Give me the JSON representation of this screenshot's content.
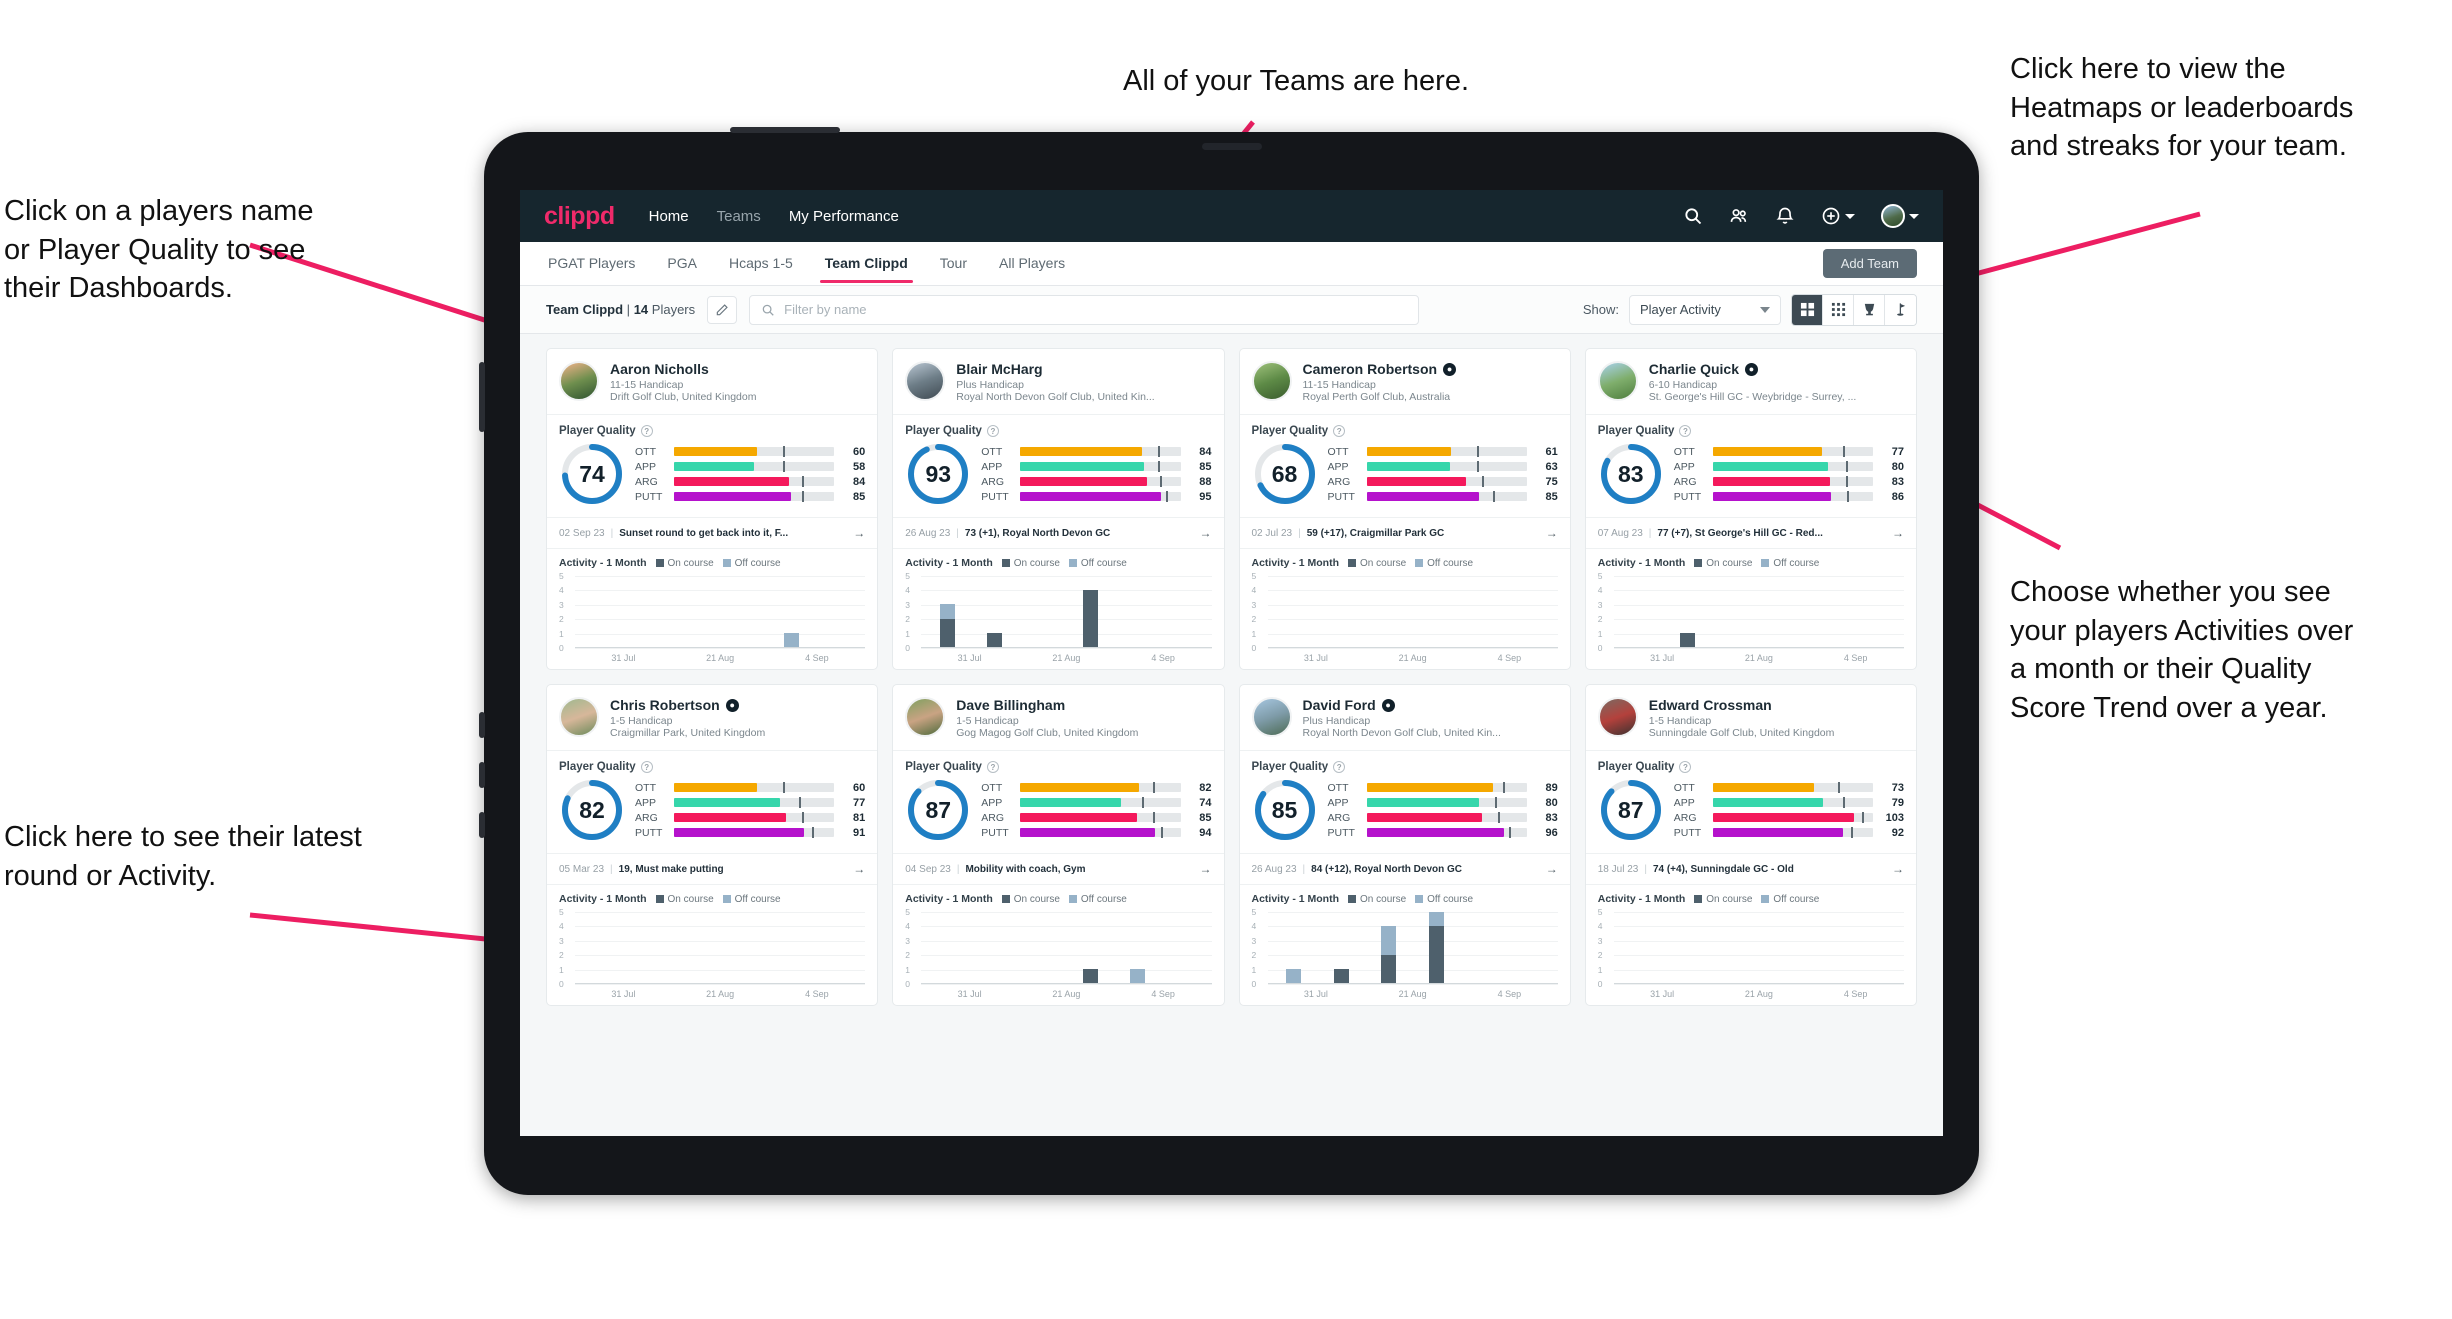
{
  "annotations": [
    {
      "id": "teams-note",
      "text": "All of your Teams are here."
    },
    {
      "id": "heatmaps-note",
      "text": "Click here to view the\nHeatmaps or leaderboards\nand streaks for your team."
    },
    {
      "id": "players-note",
      "text": "Click on a players name\nor Player Quality to see\ntheir Dashboards."
    },
    {
      "id": "activity-note",
      "text": "Choose whether you see\nyour players Activities over\na month or their Quality\nScore Trend over a year."
    },
    {
      "id": "latest-note",
      "text": "Click here to see their latest\nround or Activity."
    }
  ],
  "arrow_color": "#ed1e62",
  "app": {
    "brand": "clippd",
    "nav": [
      {
        "label": "Home",
        "active": true
      },
      {
        "label": "Teams",
        "active": false
      },
      {
        "label": "My Performance",
        "active": true
      }
    ],
    "top_icons": [
      "search-icon",
      "people-icon",
      "bell-icon",
      "plus-circle-icon",
      "avatar"
    ],
    "tabs": [
      {
        "label": "PGAT Players",
        "active": false
      },
      {
        "label": "PGA",
        "active": false
      },
      {
        "label": "Hcaps 1-5",
        "active": false
      },
      {
        "label": "Team Clippd",
        "active": true
      },
      {
        "label": "Tour",
        "active": false
      },
      {
        "label": "All Players",
        "active": false
      }
    ],
    "add_team_label": "Add Team",
    "filter": {
      "team_name": "Team Clippd",
      "separator": "|",
      "player_count": "14",
      "players_word": "Players",
      "edit_icon": "pencil-icon",
      "search_placeholder": "Filter by name",
      "show_label": "Show:",
      "show_value": "Player Activity",
      "view_buttons": [
        "grid-large-icon",
        "grid-small-icon",
        "trophy-icon",
        "flag-icon"
      ],
      "active_view": 0
    }
  },
  "quality_colors": {
    "OTT": "#f5a800",
    "APP": "#36d6ab",
    "ARG": "#f4195c",
    "PUTT": "#b512cc",
    "ring": "#1f7fc4",
    "track": "#e4e7e9"
  },
  "activity_colors": {
    "on_course": "#4e606c",
    "off_course": "#96b2c8"
  },
  "activity_legend": {
    "title": "Activity - 1 Month",
    "on": "On course",
    "off": "Off course"
  },
  "activity_axis": {
    "y_ticks": [
      "5",
      "4",
      "3",
      "2",
      "1",
      "0"
    ],
    "x_ticks": [
      "31 Jul",
      "21 Aug",
      "4 Sep"
    ],
    "ymax": 5
  },
  "card_labels": {
    "player_quality": "Player Quality",
    "help": "?"
  },
  "players": [
    {
      "name": "Aaron Nicholls",
      "verified": false,
      "handicap": "11-15 Handicap",
      "club": "Drift Golf Club, United Kingdom",
      "score": 74,
      "metrics": [
        {
          "key": "OTT",
          "value": 60,
          "fill": 52,
          "tick": 68
        },
        {
          "key": "APP",
          "value": 58,
          "fill": 50,
          "tick": 68
        },
        {
          "key": "ARG",
          "value": 84,
          "fill": 72,
          "tick": 80
        },
        {
          "key": "PUTT",
          "value": 85,
          "fill": 73,
          "tick": 80
        }
      ],
      "latest_date": "02 Sep 23",
      "latest_text": "Sunset round to get back into it, F...",
      "chart_data": {
        "type": "bar",
        "on": [
          0,
          0,
          0,
          0,
          0,
          0
        ],
        "off": [
          0,
          0,
          0,
          0,
          1,
          0
        ]
      }
    },
    {
      "name": "Blair McHarg",
      "verified": false,
      "handicap": "Plus Handicap",
      "club": "Royal North Devon Golf Club, United Kin...",
      "score": 93,
      "metrics": [
        {
          "key": "OTT",
          "value": 84,
          "fill": 76,
          "tick": 86
        },
        {
          "key": "APP",
          "value": 85,
          "fill": 77,
          "tick": 86
        },
        {
          "key": "ARG",
          "value": 88,
          "fill": 79,
          "tick": 87
        },
        {
          "key": "PUTT",
          "value": 95,
          "fill": 88,
          "tick": 91
        }
      ],
      "latest_date": "26 Aug 23",
      "latest_text": "73 (+1), Royal North Devon GC",
      "chart_data": {
        "type": "bar",
        "on": [
          2,
          1,
          0,
          4,
          0,
          0
        ],
        "off": [
          1,
          0,
          0,
          0,
          0,
          0
        ]
      }
    },
    {
      "name": "Cameron Robertson",
      "verified": true,
      "handicap": "11-15 Handicap",
      "club": "Royal Perth Golf Club, Australia",
      "score": 68,
      "metrics": [
        {
          "key": "OTT",
          "value": 61,
          "fill": 53,
          "tick": 69
        },
        {
          "key": "APP",
          "value": 63,
          "fill": 52,
          "tick": 69
        },
        {
          "key": "ARG",
          "value": 75,
          "fill": 62,
          "tick": 72
        },
        {
          "key": "PUTT",
          "value": 85,
          "fill": 70,
          "tick": 79
        }
      ],
      "latest_date": "02 Jul 23",
      "latest_text": "59 (+17), Craigmillar Park GC",
      "chart_data": {
        "type": "bar",
        "on": [
          0,
          0,
          0,
          0,
          0,
          0
        ],
        "off": [
          0,
          0,
          0,
          0,
          0,
          0
        ]
      }
    },
    {
      "name": "Charlie Quick",
      "verified": true,
      "handicap": "6-10 Handicap",
      "club": "St. George's Hill GC - Weybridge - Surrey, ...",
      "score": 83,
      "metrics": [
        {
          "key": "OTT",
          "value": 77,
          "fill": 68,
          "tick": 81
        },
        {
          "key": "APP",
          "value": 80,
          "fill": 72,
          "tick": 83
        },
        {
          "key": "ARG",
          "value": 83,
          "fill": 73,
          "tick": 83
        },
        {
          "key": "PUTT",
          "value": 86,
          "fill": 74,
          "tick": 84
        }
      ],
      "latest_date": "07 Aug 23",
      "latest_text": "77 (+7), St George's Hill GC - Red...",
      "chart_data": {
        "type": "bar",
        "on": [
          0,
          1,
          0,
          0,
          0,
          0
        ],
        "off": [
          0,
          0,
          0,
          0,
          0,
          0
        ]
      }
    },
    {
      "name": "Chris Robertson",
      "verified": true,
      "handicap": "1-5 Handicap",
      "club": "Craigmillar Park, United Kingdom",
      "score": 82,
      "metrics": [
        {
          "key": "OTT",
          "value": 60,
          "fill": 52,
          "tick": 68
        },
        {
          "key": "APP",
          "value": 77,
          "fill": 66,
          "tick": 78
        },
        {
          "key": "ARG",
          "value": 81,
          "fill": 70,
          "tick": 80
        },
        {
          "key": "PUTT",
          "value": 91,
          "fill": 81,
          "tick": 86
        }
      ],
      "latest_date": "05 Mar 23",
      "latest_text": "19, Must make putting",
      "chart_data": {
        "type": "bar",
        "on": [
          0,
          0,
          0,
          0,
          0,
          0
        ],
        "off": [
          0,
          0,
          0,
          0,
          0,
          0
        ]
      }
    },
    {
      "name": "Dave Billingham",
      "verified": false,
      "handicap": "1-5 Handicap",
      "club": "Gog Magog Golf Club, United Kingdom",
      "score": 87,
      "metrics": [
        {
          "key": "OTT",
          "value": 82,
          "fill": 74,
          "tick": 83
        },
        {
          "key": "APP",
          "value": 74,
          "fill": 63,
          "tick": 76
        },
        {
          "key": "ARG",
          "value": 85,
          "fill": 73,
          "tick": 83
        },
        {
          "key": "PUTT",
          "value": 94,
          "fill": 84,
          "tick": 88
        }
      ],
      "latest_date": "04 Sep 23",
      "latest_text": "Mobility with coach, Gym",
      "chart_data": {
        "type": "bar",
        "on": [
          0,
          0,
          0,
          1,
          0,
          0
        ],
        "off": [
          0,
          0,
          0,
          0,
          1,
          0
        ]
      }
    },
    {
      "name": "David Ford",
      "verified": true,
      "handicap": "Plus Handicap",
      "club": "Royal North Devon Golf Club, United Kin...",
      "score": 85,
      "metrics": [
        {
          "key": "OTT",
          "value": 89,
          "fill": 79,
          "tick": 85
        },
        {
          "key": "APP",
          "value": 80,
          "fill": 70,
          "tick": 80
        },
        {
          "key": "ARG",
          "value": 83,
          "fill": 72,
          "tick": 82
        },
        {
          "key": "PUTT",
          "value": 96,
          "fill": 86,
          "tick": 89
        }
      ],
      "latest_date": "26 Aug 23",
      "latest_text": "84 (+12), Royal North Devon GC",
      "chart_data": {
        "type": "bar",
        "on": [
          0,
          1,
          2,
          4,
          0,
          0
        ],
        "off": [
          1,
          0,
          2,
          1,
          0,
          0
        ]
      }
    },
    {
      "name": "Edward Crossman",
      "verified": false,
      "handicap": "1-5 Handicap",
      "club": "Sunningdale Golf Club, United Kingdom",
      "score": 87,
      "metrics": [
        {
          "key": "OTT",
          "value": 73,
          "fill": 63,
          "tick": 78
        },
        {
          "key": "APP",
          "value": 79,
          "fill": 69,
          "tick": 81
        },
        {
          "key": "ARG",
          "value": 103,
          "fill": 88,
          "tick": 93
        },
        {
          "key": "PUTT",
          "value": 92,
          "fill": 81,
          "tick": 86
        }
      ],
      "latest_date": "18 Jul 23",
      "latest_text": "74 (+4), Sunningdale GC - Old",
      "chart_data": {
        "type": "bar",
        "on": [
          0,
          0,
          0,
          0,
          0,
          0
        ],
        "off": [
          0,
          0,
          0,
          0,
          0,
          0
        ]
      }
    }
  ]
}
